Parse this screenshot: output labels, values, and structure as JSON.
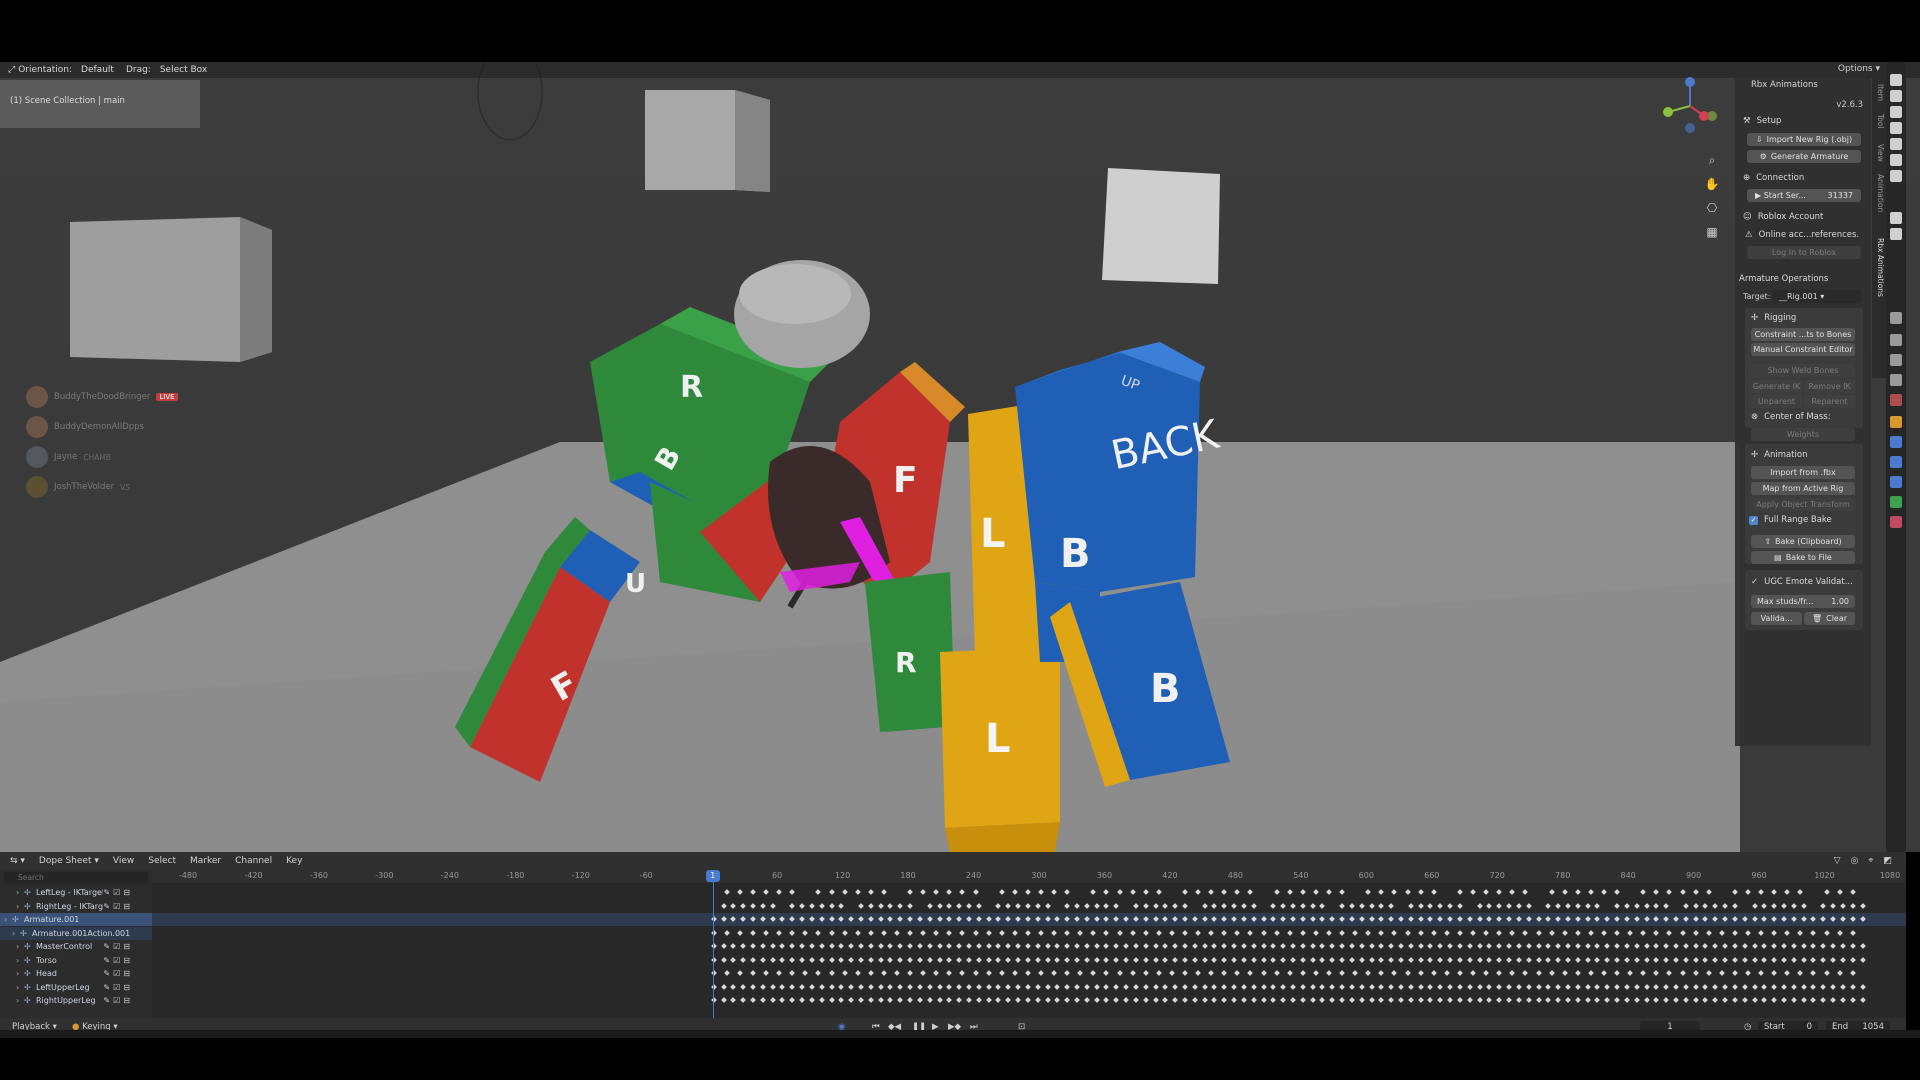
{
  "viewport": {
    "header": {
      "orientation_label": "Orientation:",
      "orientation_value": "Default",
      "drag_label": "Drag:",
      "drag_value": "Select Box",
      "options_label": "Options"
    },
    "scene_label": "(1) Scene Collection | main",
    "cube_letters": {
      "r": "R",
      "b": "B",
      "f": "F",
      "l": "L",
      "back": "BACK",
      "u": "U",
      "up": "UP"
    },
    "participants": [
      {
        "name": "BuddyTheDoodBringer",
        "badge": "LIVE"
      },
      {
        "name": "BuddyDemonAllDpps",
        "badge": ""
      },
      {
        "name": "Jayne",
        "badge": "CHAMB"
      },
      {
        "name": "JoshTheVolder",
        "badge": "VS"
      }
    ]
  },
  "sidebar": {
    "title": "Rbx Animations",
    "version": "v2.6.3",
    "setup": {
      "heading": "Setup",
      "import_rig": "Import New Rig (.obj)",
      "generate_armature": "Generate Armature"
    },
    "connection": {
      "heading": "Connection",
      "start_server": "Start Ser...",
      "port": "31337"
    },
    "roblox_account": {
      "heading": "Roblox Account",
      "warning": "Online acc...references.",
      "login": "Log In to Roblox"
    },
    "armature_ops": {
      "heading": "Armature Operations",
      "target_label": "Target:",
      "target_value": "__Rig.001"
    },
    "rigging": {
      "heading": "Rigging",
      "constraint_to_bones": "Constraint ...ts to Bones",
      "manual_constraint_editor": "Manual Constraint Editor",
      "show_weld_bones": "Show Weld Bones",
      "generate_ik": "Generate IK",
      "remove_ik": "Remove IK",
      "unparent": "Unparent",
      "reparent": "Reparent",
      "center_of_mass": "Center of Mass:",
      "weights": "Weights"
    },
    "animation": {
      "heading": "Animation",
      "import_fbx": "Import from .fbx",
      "map_active_rig": "Map from Active Rig",
      "apply_transform": "Apply Object Transform",
      "full_range_bake": "Full Range Bake",
      "bake_clipboard": "Bake (Clipboard)",
      "bake_file": "Bake to File"
    },
    "ugc": {
      "heading": "UGC Emote Validat...",
      "max_studs_label": "Max studs/fr...",
      "max_studs_value": "1.00",
      "validate": "Valida...",
      "clear": "Clear"
    },
    "vertical_tabs": [
      "Item",
      "Tool",
      "View",
      "Animation",
      "Rbx Animations"
    ]
  },
  "dope_sheet": {
    "editor_mode": "Dope Sheet",
    "menus": [
      "View",
      "Select",
      "Marker",
      "Channel",
      "Key"
    ],
    "search_placeholder": "Search",
    "ruler_ticks": [
      "-480",
      "-420",
      "-360",
      "-300",
      "-240",
      "-180",
      "-120",
      "-60",
      "0",
      "60",
      "120",
      "180",
      "240",
      "300",
      "360",
      "420",
      "480",
      "540",
      "600",
      "660",
      "720",
      "780",
      "840",
      "900",
      "960",
      "1020",
      "1080"
    ],
    "playhead_frame": "1",
    "channels": [
      {
        "name": "LeftLeg - IKTarget",
        "type": "bone"
      },
      {
        "name": "RightLeg - IKTarget",
        "type": "bone"
      },
      {
        "name": "Armature.001",
        "type": "armature"
      },
      {
        "name": "Armature.001Action.001",
        "type": "action"
      },
      {
        "name": "MasterControl",
        "type": "bone"
      },
      {
        "name": "Torso",
        "type": "bone"
      },
      {
        "name": "Head",
        "type": "bone"
      },
      {
        "name": "LeftUpperLeg",
        "type": "bone"
      },
      {
        "name": "RightUpperLeg",
        "type": "bone"
      }
    ],
    "footer": {
      "playback": "Playback",
      "keying": "Keying",
      "current_frame": "1",
      "start_label": "Start",
      "start_value": "0",
      "end_label": "End",
      "end_value": "1054"
    }
  },
  "colors": {
    "accent_blue": "#4a7bd0",
    "cube_red": "#c0322b",
    "cube_blue": "#1f5fb5",
    "cube_green": "#2e8a3a",
    "cube_yellow": "#e0a514",
    "bone_magenta": "#e020e0"
  }
}
